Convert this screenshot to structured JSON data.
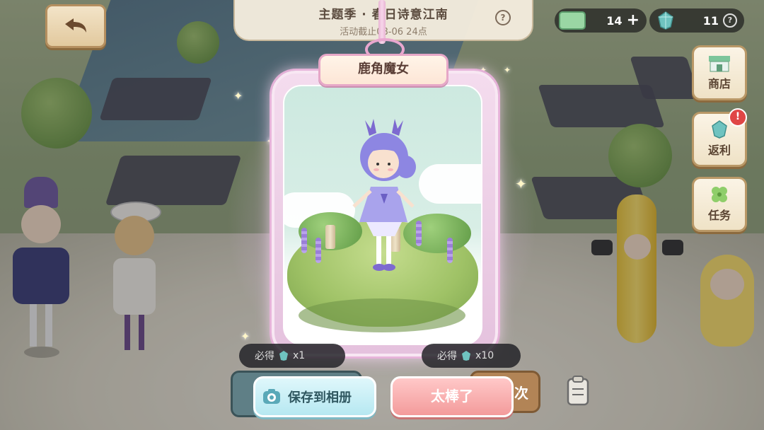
{
  "header": {
    "back_label": "",
    "title": "主题季 · 春日诗意江南",
    "subtitle": "活动截止08-06 24点",
    "help": "?"
  },
  "currency": {
    "money_value": "14",
    "money_plus": "+",
    "gem_value": "11",
    "gem_help": "?"
  },
  "side_menu": {
    "shop_label": "商店",
    "rebate_label": "返利",
    "rebate_badge": "!",
    "task_label": "任务"
  },
  "card": {
    "name": "鹿角魔女"
  },
  "rewards": {
    "left_label": "必得",
    "left_qty": "x1",
    "right_label": "必得",
    "right_qty": "x10"
  },
  "buttons": {
    "save_label": "保存到相册",
    "great_label": "太棒了",
    "behind_right_label": "次"
  },
  "colors": {
    "accent_pink": "#f39b9b",
    "accent_cyan": "#b6e8f1",
    "frame_pink": "#e6a7c7",
    "badge_red": "#e04646"
  }
}
